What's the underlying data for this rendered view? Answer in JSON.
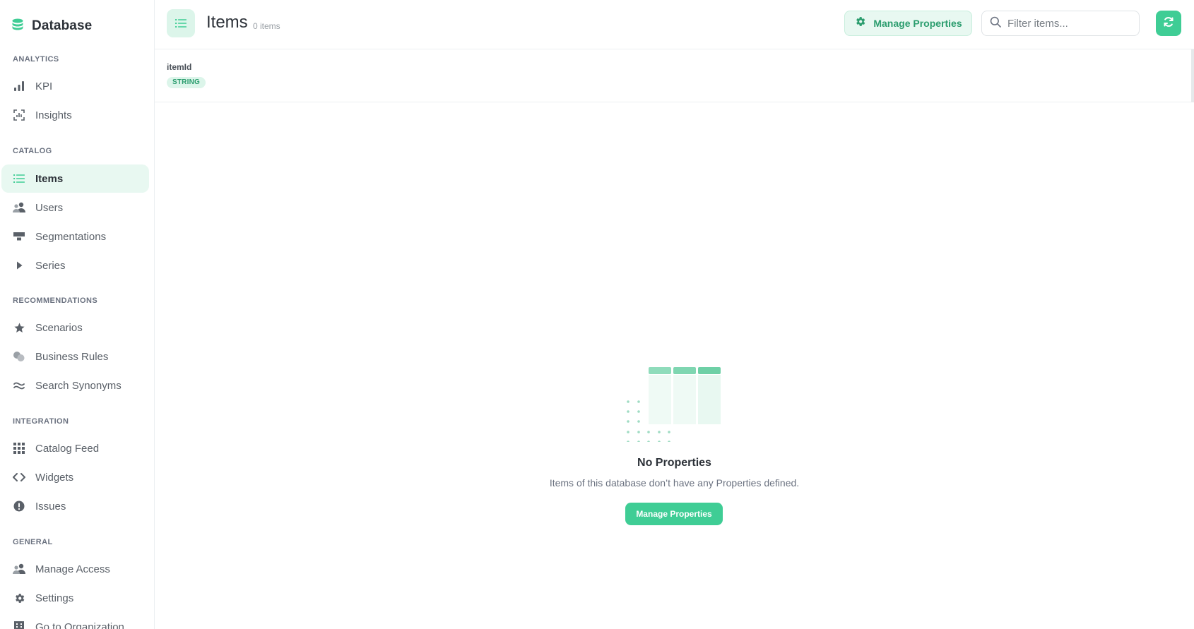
{
  "sidebar": {
    "brand": "Database",
    "sections": {
      "analytics": "ANALYTICS",
      "catalog": "CATALOG",
      "recommendations": "RECOMMENDATIONS",
      "integration": "INTEGRATION",
      "general": "GENERAL"
    },
    "items": {
      "kpi": "KPI",
      "insights": "Insights",
      "items": "Items",
      "users": "Users",
      "segmentations": "Segmentations",
      "series": "Series",
      "scenarios": "Scenarios",
      "business_rules": "Business Rules",
      "search_synonyms": "Search Synonyms",
      "catalog_feed": "Catalog Feed",
      "widgets": "Widgets",
      "issues": "Issues",
      "manage_access": "Manage Access",
      "settings": "Settings",
      "go_to_organization": "Go to Organization"
    },
    "active": "items"
  },
  "header": {
    "title": "Items",
    "count": "0 items",
    "manage_properties": "Manage Properties",
    "search_placeholder": "Filter items..."
  },
  "columns": [
    {
      "name": "itemId",
      "type": "STRING"
    }
  ],
  "empty_state": {
    "title": "No Properties",
    "description": "Items of this database don’t have any Properties defined.",
    "button": "Manage Properties"
  },
  "colors": {
    "accent": "#3fcd95",
    "accent_text": "#2b9d6e",
    "accent_light": "#e8f8f1"
  }
}
